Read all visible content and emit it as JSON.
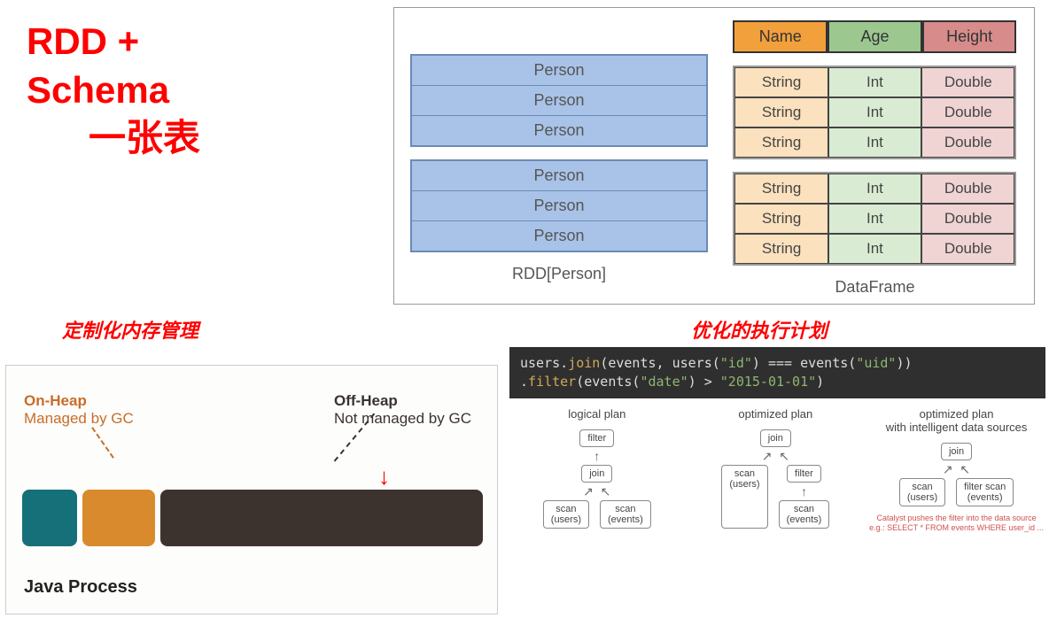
{
  "title_line1": "RDD +",
  "title_line2": "Schema",
  "title_line3": "一张表",
  "subtitle_memory": "定制化内存管理",
  "subtitle_plan": "优化的执行计划",
  "rdd_person": "Person",
  "rdd_caption": "RDD[Person]",
  "df_caption": "DataFrame",
  "df_headers": {
    "name": "Name",
    "age": "Age",
    "height": "Height"
  },
  "df_types": {
    "str": "String",
    "int": "Int",
    "dbl": "Double"
  },
  "heap": {
    "on_title": "On-Heap",
    "on_sub": "Managed by GC",
    "off_title": "Off-Heap",
    "off_sub": "Not managed by GC",
    "java": "Java Process"
  },
  "code": {
    "p1": "users.",
    "join": "join",
    "p2": "(events, users(",
    "id": "\"id\"",
    "p3": ") === events(",
    "uid": "\"uid\"",
    "p4": "))",
    "p5": "      .",
    "filter": "filter",
    "p6": "(events(",
    "date": "\"date\"",
    "p7": ") > ",
    "dstr": "\"2015-01-01\"",
    "p8": ")"
  },
  "plans": {
    "p1_title": "logical plan",
    "p2_title": "optimized plan",
    "p3_title": "optimized plan\nwith intelligent data sources",
    "filter": "filter",
    "join": "join",
    "scan_users": "scan\n(users)",
    "scan_events": "scan\n(events)",
    "filter_scan_events": "filter scan\n(events)",
    "catalyst": "Catalyst pushes the filter into the data source\ne.g.: SELECT * FROM events WHERE user_id ..."
  },
  "chart_data": {
    "type": "diagram",
    "rdd_rows": 6,
    "df_rows": 6,
    "df_schema": [
      {
        "name": "Name",
        "type": "String"
      },
      {
        "name": "Age",
        "type": "Int"
      },
      {
        "name": "Height",
        "type": "Double"
      }
    ],
    "heap_segments": [
      "on-heap-small-teal",
      "on-heap-orange",
      "off-heap-large-dark"
    ],
    "code_expression": "users.join(events, users(\"id\") === events(\"uid\")).filter(events(\"date\") > \"2015-01-01\")",
    "plans": [
      {
        "name": "logical plan",
        "tree": [
          "filter",
          "join",
          [
            "scan(users)",
            "scan(events)"
          ]
        ]
      },
      {
        "name": "optimized plan",
        "tree": [
          "join",
          [
            "scan(users)",
            [
              "filter",
              "scan(events)"
            ]
          ]
        ]
      },
      {
        "name": "optimized plan with intelligent data sources",
        "tree": [
          "join",
          [
            "scan(users)",
            "filter scan(events)"
          ]
        ]
      }
    ]
  }
}
